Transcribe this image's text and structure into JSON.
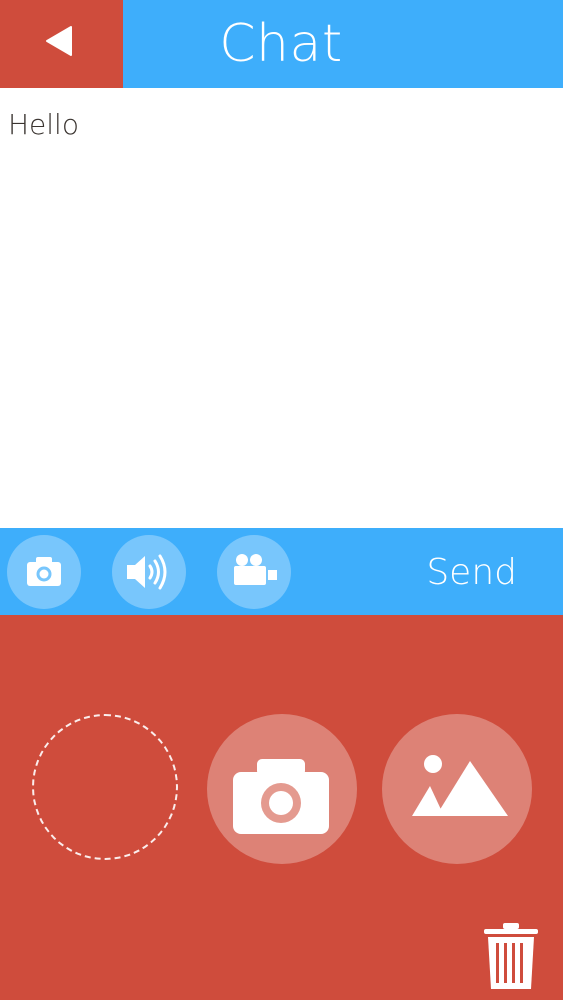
{
  "header": {
    "title": "Chat",
    "background_color": "#3eaefb",
    "back_button_color": "#cf4c3c",
    "back_icon": "back-triangle-icon"
  },
  "messages": [
    {
      "text": "Hello"
    }
  ],
  "toolbar": {
    "background_color": "#3eaefb",
    "icons": [
      "camera-icon",
      "speaker-icon",
      "video-camera-icon"
    ],
    "send_label": "Send"
  },
  "media_panel": {
    "background_color": "#cf4c3c",
    "icons": [
      "dashed-circle-placeholder",
      "camera-icon",
      "image-gallery-icon",
      "trash-icon"
    ]
  }
}
